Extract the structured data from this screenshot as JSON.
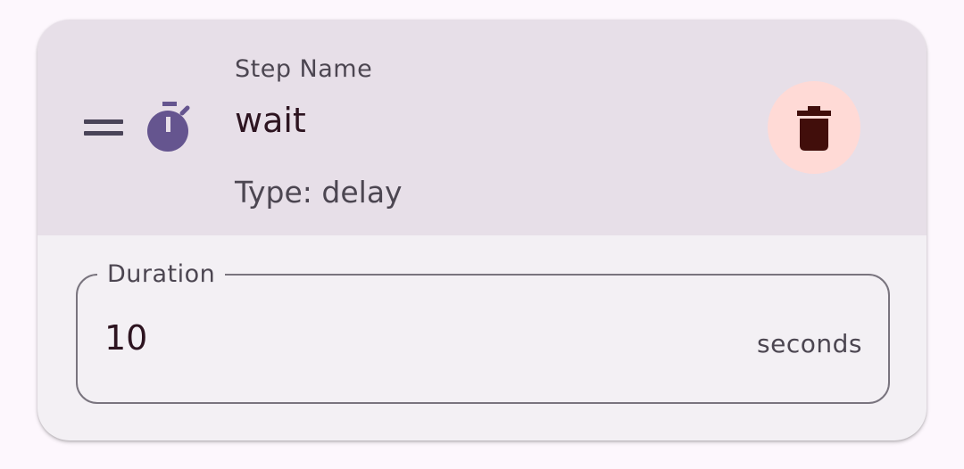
{
  "step": {
    "name_label": "Step Name",
    "name_value": "wait",
    "type_text": "Type: delay"
  },
  "icons": {
    "drag": "drag-handle-icon",
    "step": "timer-icon",
    "delete": "trash-icon"
  },
  "duration_field": {
    "label": "Duration",
    "value": "10",
    "suffix": "seconds"
  },
  "colors": {
    "header_bg": "#e7dfe8",
    "card_bg": "#f3f0f4",
    "delete_bg": "#ffdad6",
    "icon_primary": "#65558f",
    "delete_icon": "#410e0b"
  }
}
